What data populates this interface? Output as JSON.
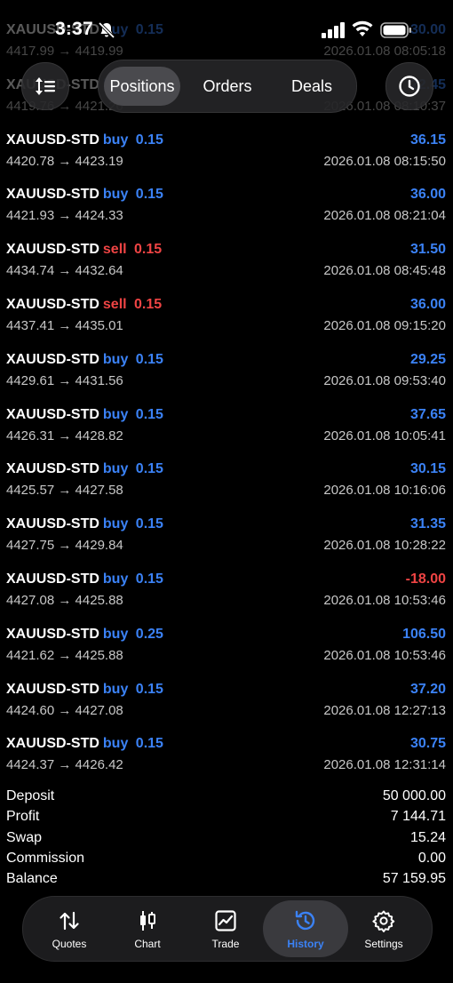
{
  "status": {
    "time": "3:37"
  },
  "header": {
    "tabs": [
      {
        "label": "Positions",
        "active": true
      },
      {
        "label": "Orders",
        "active": false
      },
      {
        "label": "Deals",
        "active": false
      }
    ]
  },
  "deals": [
    {
      "symbol": "XAUUSD-STD",
      "side": "buy",
      "volume": "0.15",
      "profit": "30.00",
      "prices": "4417.99 → 4419.99",
      "time": "2026.01.08 08:05:18"
    },
    {
      "symbol": "XAUUSD-STD",
      "side": "buy",
      "volume": "0.15",
      "profit": "22.45",
      "prices": "4419.76 → 4421.26",
      "time": "2026.01.08 08:10:37"
    },
    {
      "symbol": "XAUUSD-STD",
      "side": "buy",
      "volume": "0.15",
      "profit": "36.15",
      "prices": "4420.78 → 4423.19",
      "time": "2026.01.08 08:15:50"
    },
    {
      "symbol": "XAUUSD-STD",
      "side": "buy",
      "volume": "0.15",
      "profit": "36.00",
      "prices": "4421.93 → 4424.33",
      "time": "2026.01.08 08:21:04"
    },
    {
      "symbol": "XAUUSD-STD",
      "side": "sell",
      "volume": "0.15",
      "profit": "31.50",
      "prices": "4434.74 → 4432.64",
      "time": "2026.01.08 08:45:48"
    },
    {
      "symbol": "XAUUSD-STD",
      "side": "sell",
      "volume": "0.15",
      "profit": "36.00",
      "prices": "4437.41 → 4435.01",
      "time": "2026.01.08 09:15:20"
    },
    {
      "symbol": "XAUUSD-STD",
      "side": "buy",
      "volume": "0.15",
      "profit": "29.25",
      "prices": "4429.61 → 4431.56",
      "time": "2026.01.08 09:53:40"
    },
    {
      "symbol": "XAUUSD-STD",
      "side": "buy",
      "volume": "0.15",
      "profit": "37.65",
      "prices": "4426.31 → 4428.82",
      "time": "2026.01.08 10:05:41"
    },
    {
      "symbol": "XAUUSD-STD",
      "side": "buy",
      "volume": "0.15",
      "profit": "30.15",
      "prices": "4425.57 → 4427.58",
      "time": "2026.01.08 10:16:06"
    },
    {
      "symbol": "XAUUSD-STD",
      "side": "buy",
      "volume": "0.15",
      "profit": "31.35",
      "prices": "4427.75 → 4429.84",
      "time": "2026.01.08 10:28:22"
    },
    {
      "symbol": "XAUUSD-STD",
      "side": "buy",
      "volume": "0.15",
      "profit": "-18.00",
      "prices": "4427.08 → 4425.88",
      "time": "2026.01.08 10:53:46"
    },
    {
      "symbol": "XAUUSD-STD",
      "side": "buy",
      "volume": "0.25",
      "profit": "106.50",
      "prices": "4421.62 → 4425.88",
      "time": "2026.01.08 10:53:46"
    },
    {
      "symbol": "XAUUSD-STD",
      "side": "buy",
      "volume": "0.15",
      "profit": "37.20",
      "prices": "4424.60 → 4427.08",
      "time": "2026.01.08 12:27:13"
    },
    {
      "symbol": "XAUUSD-STD",
      "side": "buy",
      "volume": "0.15",
      "profit": "30.75",
      "prices": "4424.37 → 4426.42",
      "time": "2026.01.08 12:31:14"
    }
  ],
  "summary": [
    {
      "label": "Deposit",
      "value": "50 000.00"
    },
    {
      "label": "Profit",
      "value": "7 144.71"
    },
    {
      "label": "Swap",
      "value": "15.24"
    },
    {
      "label": "Commission",
      "value": "0.00"
    },
    {
      "label": "Balance",
      "value": "57 159.95"
    }
  ],
  "tabbar": [
    {
      "label": "Quotes",
      "icon": "quotes-icon",
      "active": false
    },
    {
      "label": "Chart",
      "icon": "chart-icon",
      "active": false
    },
    {
      "label": "Trade",
      "icon": "trade-icon",
      "active": false
    },
    {
      "label": "History",
      "icon": "history-icon",
      "active": true
    },
    {
      "label": "Settings",
      "icon": "settings-icon",
      "active": false
    }
  ],
  "colors": {
    "buy": "#3b82f6",
    "sell": "#ef4444",
    "accent": "#3b82f6",
    "background": "#000000"
  }
}
